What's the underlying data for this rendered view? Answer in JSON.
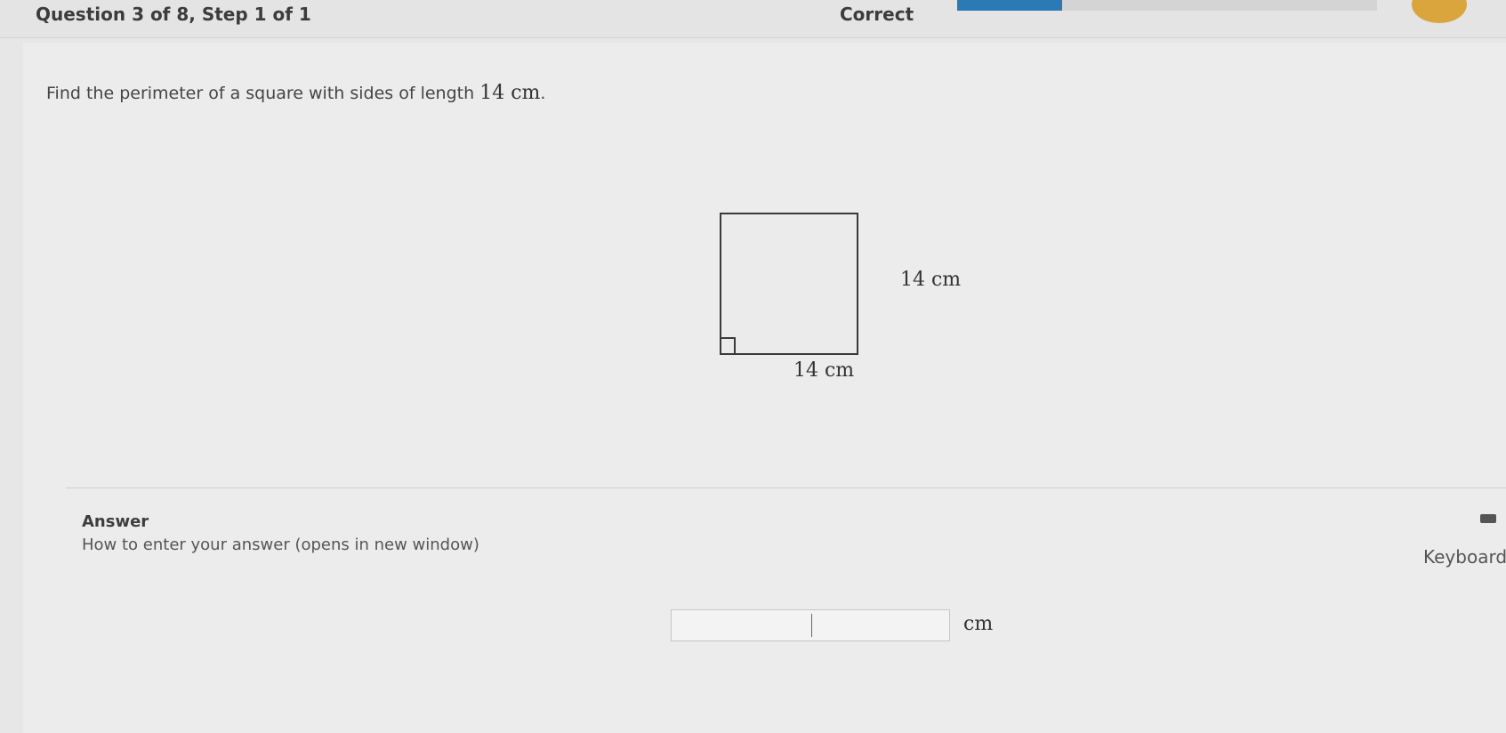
{
  "header": {
    "question_progress": "Question 3 of 8, Step 1 of 1",
    "status": "Correct",
    "progress_fraction": 0.25,
    "accent_color": "#2b79b5"
  },
  "problem": {
    "text": "Find the perimeter of a square with sides of length",
    "length": "14 cm",
    "period": "."
  },
  "figure": {
    "shape": "square",
    "side_label": "14 cm",
    "bottom_label": "14 cm"
  },
  "answer": {
    "title": "Answer",
    "help_link": "How to enter your answer (opens in new window)",
    "keyboard_label": "Keyboard Sl",
    "keyboard_letter": "K",
    "input_value": "",
    "unit": "cm"
  }
}
